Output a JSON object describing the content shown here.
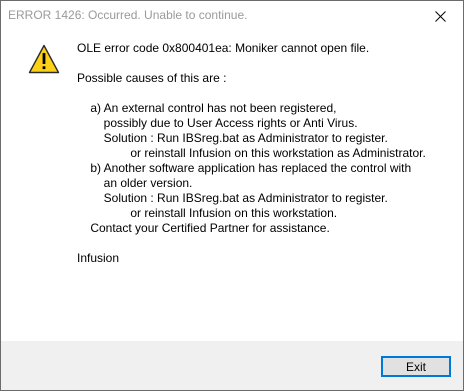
{
  "window": {
    "title": "ERROR 1426: Occurred. Unable to continue.",
    "close_icon": "close-x"
  },
  "dialog": {
    "icon": "warning-icon",
    "lines": [
      "OLE error code 0x800401ea: Moniker cannot open file.",
      "",
      "Possible causes of this are :",
      "",
      "    a) An external control has not been registered,",
      "        possibly due to User Access rights or Anti Virus.",
      "        Solution : Run IBSreg.bat as Administrator to register.",
      "                or reinstall Infusion on this workstation as Administrator.",
      "    b) Another software application has replaced the control with",
      "        an older version.",
      "        Solution : Run IBSreg.bat as Administrator to register.",
      "                or reinstall Infusion on this workstation.",
      "    Contact your Certified Partner for assistance.",
      "",
      "Infusion"
    ]
  },
  "buttons": {
    "exit_label": "Exit"
  },
  "colors": {
    "warning_fill": "#fcd116",
    "warning_outline": "#2b2b2b",
    "button_border": "#0078d7",
    "footer_bg": "#f0f0f0"
  }
}
